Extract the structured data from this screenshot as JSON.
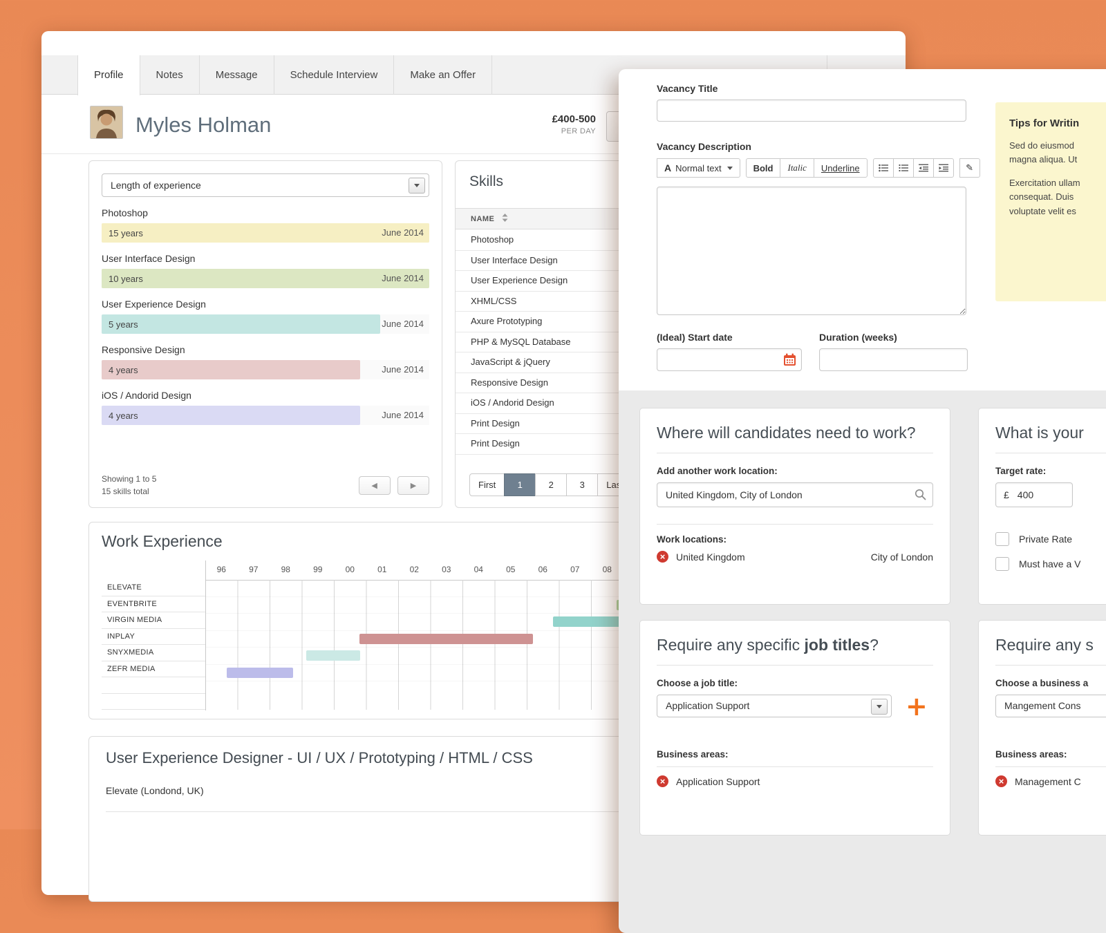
{
  "colors": {
    "background_orange": "#ED8C59",
    "accent_orange": "#F2731D",
    "danger_red": "#CF3A30",
    "active_page_bg": "#6F8090"
  },
  "profile": {
    "tabs": [
      "Profile",
      "Notes",
      "Message",
      "Schedule Interview",
      "Make an Offer"
    ],
    "name": "Myles Holman",
    "rate": "£400-500",
    "rate_unit": "PER DAY",
    "experience": {
      "filter_label": "Length of experience",
      "items": [
        {
          "skill": "Photoshop",
          "duration": "15 years",
          "date": "June 2014",
          "bar_style": "background:#F6EFC3;width:100%"
        },
        {
          "skill": "User Interface Design",
          "duration": "10 years",
          "date": "June 2014",
          "bar_style": "background:#DCE7C2;width:100%"
        },
        {
          "skill": "User Experience Design",
          "duration": "5 years",
          "date": "June 2014",
          "bar_style": "background:#C3E6E2;width:85%"
        },
        {
          "skill": "Responsive Design",
          "duration": "4 years",
          "date": "June 2014",
          "bar_style": "background:#E8CBCA;width:79%"
        },
        {
          "skill": "iOS / Andorid Design",
          "duration": "4 years",
          "date": "June 2014",
          "bar_style": "background:#DADAF4;width:79%"
        }
      ],
      "footer": {
        "line1": "Showing 1 to 5",
        "line2": "15 skills total"
      }
    },
    "skills": {
      "title": "Skills",
      "col": "NAME",
      "rows": [
        "Photoshop",
        "User Interface Design",
        "User Experience Design",
        "XHML/CSS",
        "Axure Prototyping",
        "PHP & MySQL Database",
        "JavaScript & jQuery",
        "Responsive Design",
        "iOS / Andorid Design",
        "Print Design",
        "Print Design"
      ],
      "pagination": [
        "First",
        "1",
        "2",
        "3",
        "Last"
      ]
    },
    "work": {
      "title": "Work Experience",
      "years": [
        "96",
        "97",
        "98",
        "99",
        "00",
        "01",
        "02",
        "03",
        "04",
        "05",
        "06",
        "07",
        "08"
      ],
      "rows": [
        {
          "company": "ELEVATE",
          "bar_style": "display:none"
        },
        {
          "company": "EVENTBRITE",
          "bar_style": "left:98.2%;width:5%;background:#AFD9A6"
        },
        {
          "company": "VIRGIN MEDIA",
          "bar_style": "left:82.9%;width:19.5%;background:#92D3CB"
        },
        {
          "company": "INPLAY",
          "bar_style": "left:36.7%;width:41.4%;background:#CE9292"
        },
        {
          "company": "SNYXMEDIA",
          "bar_style": "left:23.9%;width:12.9%;background:#CBE9E5"
        },
        {
          "company": "ZEFR MEDIA",
          "bar_style": "left:5%;width:15.8%;background:#BCBCEA"
        }
      ]
    },
    "job": {
      "title": "User Experience Designer - UI / UX / Prototyping / HTML / CSS",
      "company": "Elevate (Londond, UK)"
    }
  },
  "vacancy": {
    "title_label": "Vacancy Title",
    "desc_label": "Vacancy Description",
    "toolbar": {
      "format_a": "A",
      "format": "Normal text",
      "bold": "Bold",
      "italic": "Italic",
      "underline": "Underline",
      "pencil": "✎"
    },
    "tips": {
      "heading": "Tips for Writin",
      "lines": [
        "Sed do eiusmod",
        "magna aliqua. Ut",
        "Exercitation ullam",
        "consequat. Duis",
        "voluptate velit es"
      ]
    },
    "start_label": "(Ideal) Start date",
    "duration_label": "Duration (weeks)",
    "location_panel": {
      "heading": "Where will candidates need to work?",
      "add_label": "Add another work location:",
      "search_value": "United Kingdom, City of London",
      "list_label": "Work locations:",
      "item_country": "United Kingdom",
      "item_city": "City of London"
    },
    "rate_panel": {
      "heading": "What is your",
      "target_label": "Target rate:",
      "currency": "£",
      "amount": "400",
      "checkbox1": "Private Rate",
      "checkbox2": "Must have a V"
    },
    "jobtitle_panel": {
      "heading_normal": "Require any specific ",
      "heading_bold": "job titles",
      "heading_q": "?",
      "choose_label": "Choose a job title:",
      "select_value": "Application Support",
      "list_label": "Business areas:",
      "item": "Application Support"
    },
    "business_panel": {
      "heading": "Require any s",
      "choose_label": "Choose a business a",
      "select_value": "Mangement Cons",
      "list_label": "Business areas:",
      "item": "Management C"
    }
  }
}
